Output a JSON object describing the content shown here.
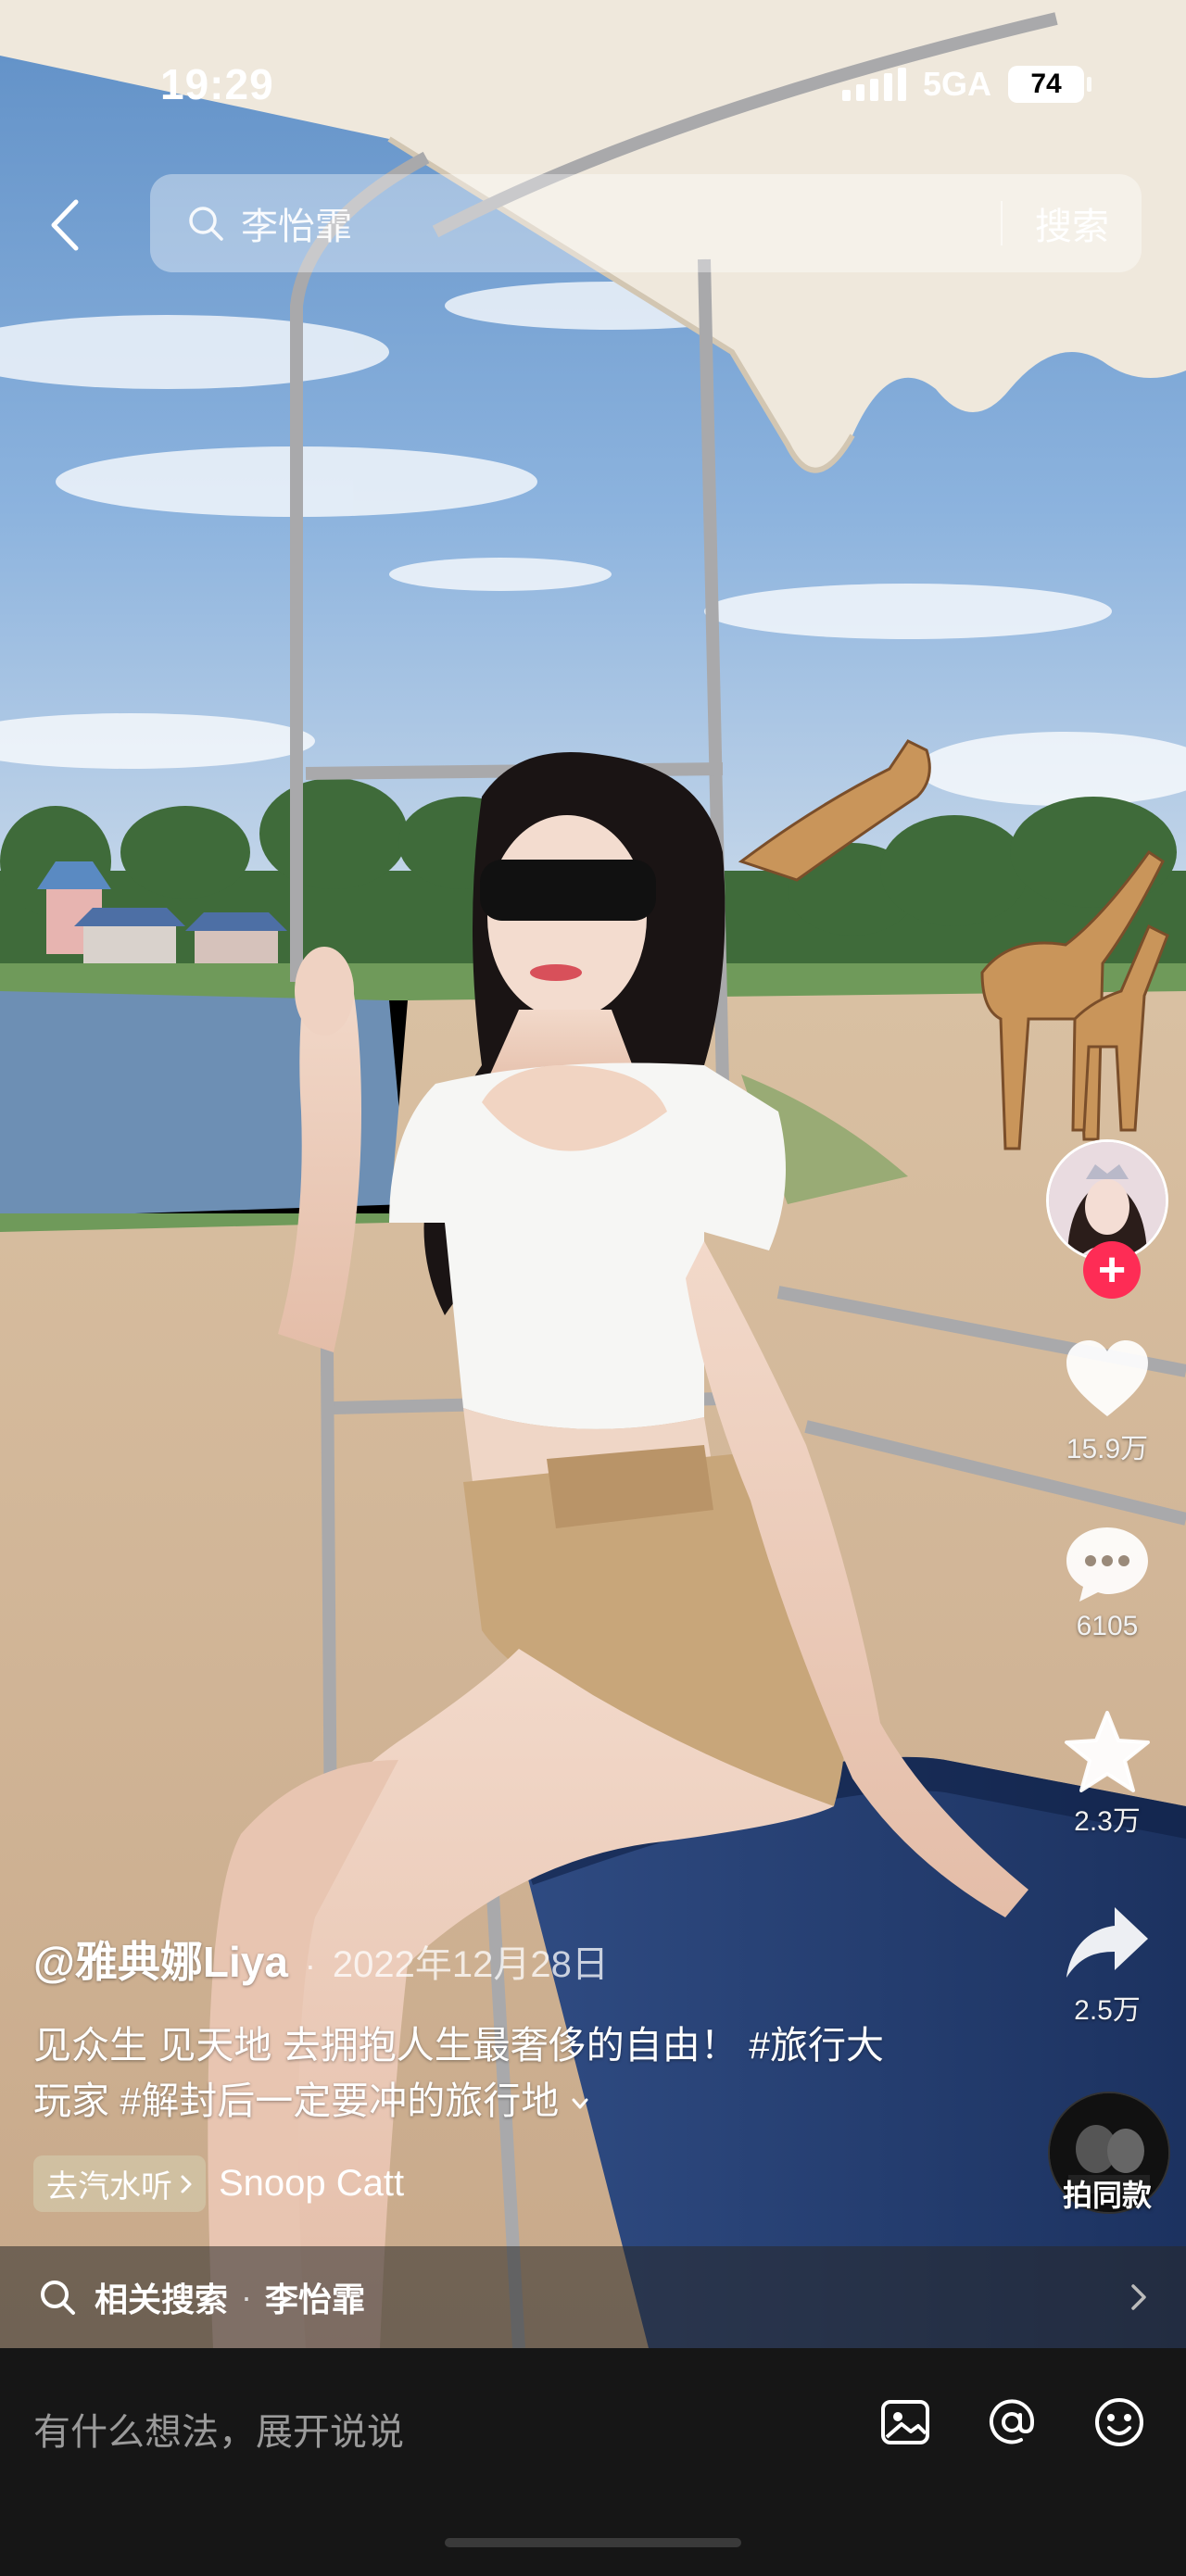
{
  "status_bar": {
    "time": "19:29",
    "network": "5GA",
    "battery": "74"
  },
  "search": {
    "query": "李怡霏",
    "button_label": "搜索"
  },
  "actions": {
    "likes": "15.9万",
    "comments": "6105",
    "favorites": "2.3万",
    "shares": "2.5万",
    "same_style_label": "拍同款"
  },
  "post": {
    "author": "@雅典娜Liya",
    "separator": "·",
    "date": "2022年12月28日",
    "caption_line1_text": "见众生 见天地 去拥抱人生最奢侈的自由！",
    "caption_line1_tag": "#旅行大",
    "caption_line2": "玩家 #解封后一定要冲的旅行地"
  },
  "music": {
    "pill_label": "去汽水听",
    "title": "Snoop Catt"
  },
  "related": {
    "label": "相关搜索",
    "dot": "·",
    "term": "李怡霏"
  },
  "comment_bar": {
    "placeholder": "有什么想法，展开说说"
  },
  "icons": [
    "back-arrow-icon",
    "search-icon",
    "heart-icon",
    "comment-icon",
    "star-icon",
    "share-icon",
    "image-icon",
    "mention-icon",
    "emoji-icon",
    "chevron-right-icon",
    "chevron-down-icon",
    "plus-icon"
  ],
  "colors": {
    "follow_red": "#fe2c55",
    "comment_bar_bg": "#161616"
  }
}
